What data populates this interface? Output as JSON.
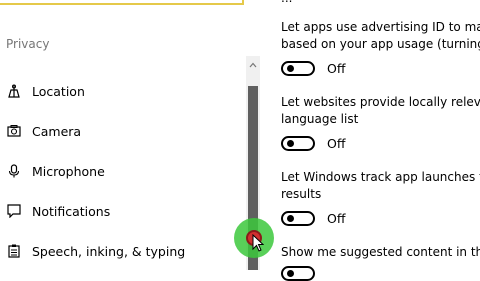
{
  "sidebar": {
    "section_title": "Privacy",
    "items": [
      {
        "label": "Location",
        "icon": "location-icon"
      },
      {
        "label": "Camera",
        "icon": "camera-icon"
      },
      {
        "label": "Microphone",
        "icon": "microphone-icon"
      },
      {
        "label": "Notifications",
        "icon": "notifications-icon"
      },
      {
        "label": "Speech, inking, & typing",
        "icon": "speech-icon"
      }
    ]
  },
  "settings": [
    {
      "line1": "Let apps use advertising ID to make",
      "line2": "based on your app usage (turning th",
      "state": "Off"
    },
    {
      "line1": "Let websites provide locally relevant",
      "line2": "language list",
      "state": "Off"
    },
    {
      "line1": "Let Windows track app launches to i",
      "line2": "results",
      "state": "Off"
    },
    {
      "line1": "Show me suggested content in the S",
      "line2": "",
      "state": ""
    }
  ],
  "colors": {
    "accent_search_border": "#e5c94a",
    "scroll_thumb": "#5f5f5f",
    "cursor_highlight": "#3cc83c"
  }
}
